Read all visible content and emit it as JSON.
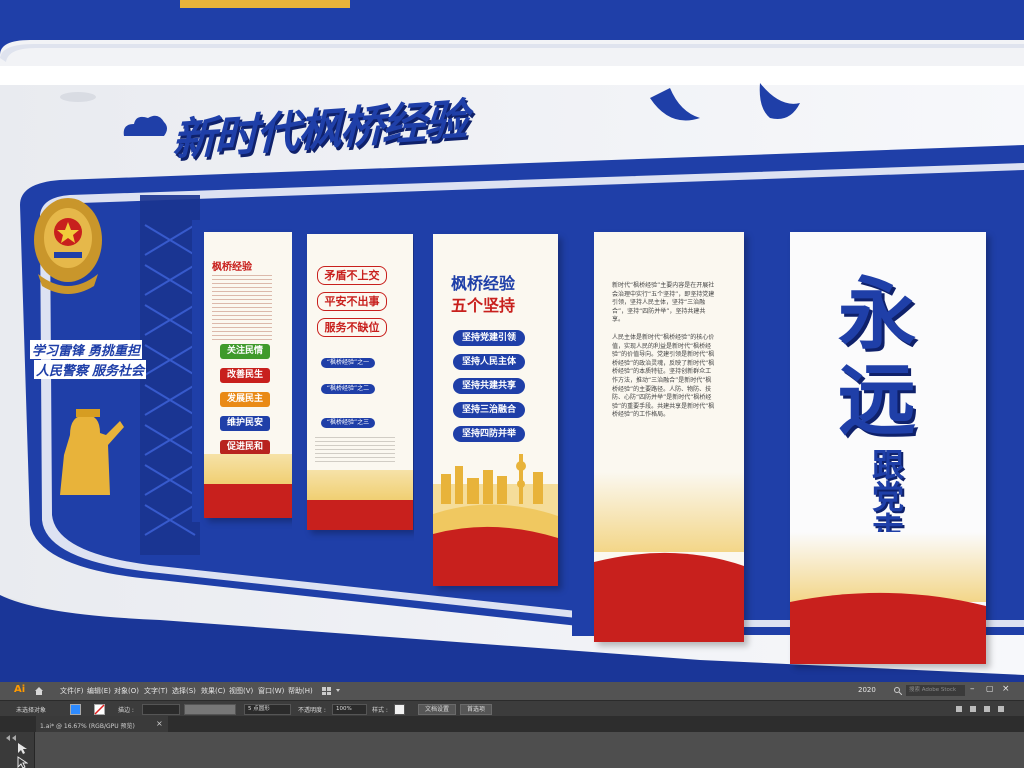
{
  "scene": {
    "top_title": "新时代枫桥经验",
    "left_slogans": [
      "学习雷锋",
      "勇挑重担",
      "人民警察",
      "服务社会"
    ],
    "panel1": {
      "heading": "枫桥经验",
      "items": [
        "关注民情",
        "改善民生",
        "发展民主",
        "维护民安",
        "促进民和"
      ]
    },
    "panel2": {
      "lines": [
        "矛盾不上交",
        "平安不出事",
        "服务不缺位"
      ],
      "subitems": [
        "“枫桥经验”之一",
        "“枫桥经验”之二",
        "“枫桥经验”之三"
      ]
    },
    "panel3": {
      "title_line1": "枫桥经验",
      "title_line2": "五个坚持",
      "items": [
        "坚持党建引领",
        "坚持人民主体",
        "坚持共建共享",
        "坚持三治融合",
        "坚持四防并举"
      ]
    },
    "panel4": {
      "para1": "新时代“枫桥经验”主要内容是在开展社会治理中实行“五个坚持”，即坚持党建引领，坚持人民主体，坚持“三治融合”，坚持“四防并举”，坚持共建共享。",
      "para2": "人民主体是新时代“枫桥经验”的核心价值，实现人民的利益是新时代“枫桥经验”的价值导向。党建引领是新时代“枫桥经验”的政治灵魂，反映了新时代“枫桥经验”的本质特征。坚持创新群众工作方法，推动“三治融合”是新时代“枫桥经验”的主要路径。人防、物防、技防、心防“四防并举”是新时代“枫桥经验”的重要手段。共建共享是新时代“枫桥经验”的工作格局。"
    },
    "panel5": {
      "big1": "永",
      "big2": "远",
      "small": "跟党走"
    }
  },
  "illustrator": {
    "logo": "Ai",
    "menu": [
      "文件(F)",
      "编辑(E)",
      "对象(O)",
      "文字(T)",
      "选择(S)",
      "效果(C)",
      "视图(V)",
      "窗口(W)",
      "帮助(H)"
    ],
    "version": "2020",
    "search_placeholder": "搜索 Adobe Stock",
    "control": {
      "no_selection": "未选择对象",
      "stroke_label": "描边 :",
      "brush_size": "5 点圆形",
      "opacity_label": "不透明度 :",
      "opacity_value": "100%",
      "style_label": "样式 :",
      "doc_setup": "文档设置",
      "preferences": "首选项"
    },
    "tab_title": "1.ai* @ 16.67% (RGB/GPU 预览)",
    "tab_close": "×"
  },
  "colors": {
    "blue": "#1f3fa8",
    "dark_blue": "#152c82",
    "red": "#c8201d",
    "gold": "#e8b33a"
  }
}
